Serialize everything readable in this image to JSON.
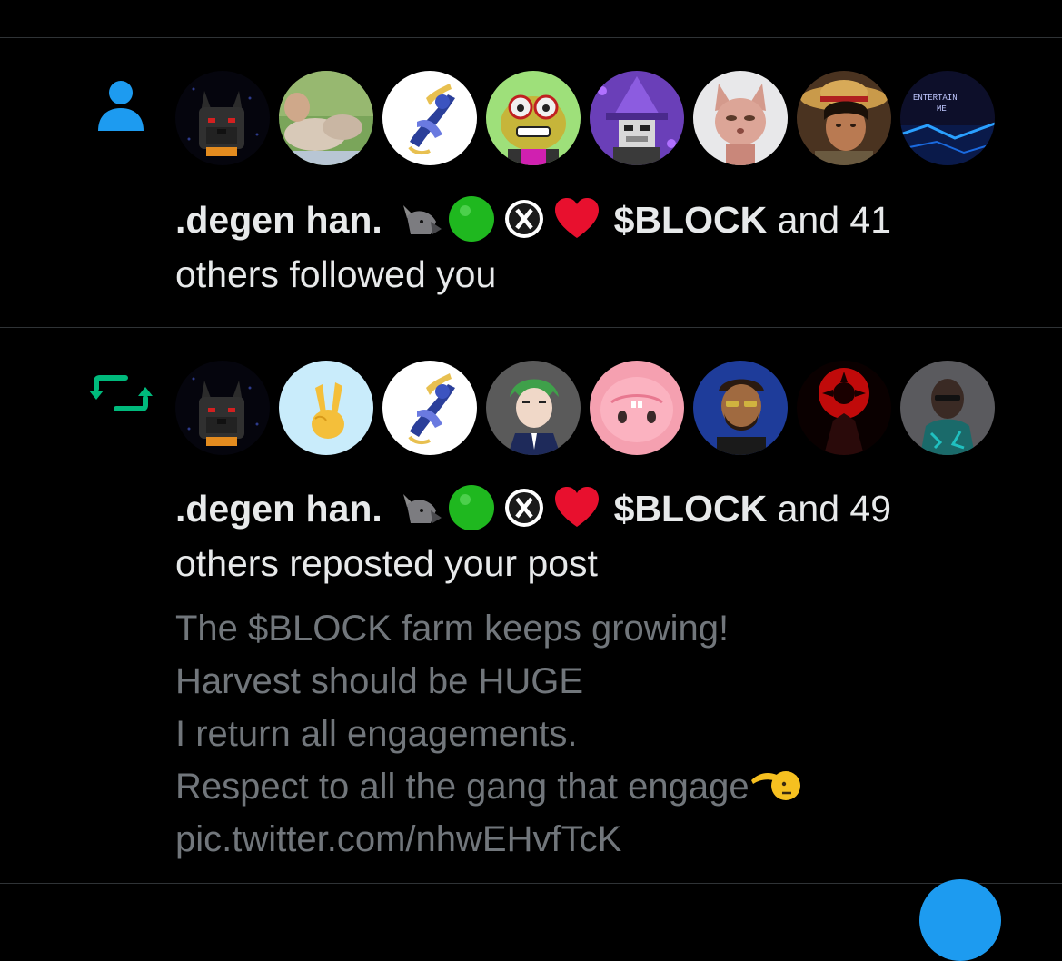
{
  "notifications": [
    {
      "type_icon": "person-icon",
      "actor_name": ".degen han.",
      "block_tag": "$BLOCK",
      "tail": " and 41",
      "second_line": "others followed you",
      "avatars": [
        "wolf-avatar",
        "landscape-avatar",
        "anime-dragon-avatar",
        "frog-glasses-avatar",
        "pixel-wizard-avatar",
        "cat-avatar",
        "straw-hat-avatar",
        "entertain-me-avatar"
      ]
    },
    {
      "type_icon": "repost-icon",
      "actor_name": ".degen han.",
      "block_tag": "$BLOCK",
      "tail": " and 49",
      "second_line": "others reposted your post",
      "avatars": [
        "wolf-avatar",
        "peace-hand-avatar",
        "anime-dragon-avatar",
        "green-hair-avatar",
        "pink-creature-avatar",
        "bearded-man-avatar",
        "red-eye-avatar",
        "dark-figure-avatar"
      ],
      "post_lines": [
        "The $BLOCK farm keeps growing!",
        "Harvest should be HUGE",
        "I return all engagements.",
        "Respect to all the gang that engage",
        "pic.twitter.com/nhwEHvfTcK"
      ]
    }
  ],
  "colors": {
    "accent": "#1d9bf0",
    "repost": "#00ba7c",
    "text_primary": "#e7e9ea",
    "text_secondary": "#71767b",
    "divider": "#2f3336"
  },
  "name_emojis": [
    "wolf-emoji",
    "green-circle-emoji",
    "x-circle-emoji",
    "red-heart-emoji"
  ]
}
